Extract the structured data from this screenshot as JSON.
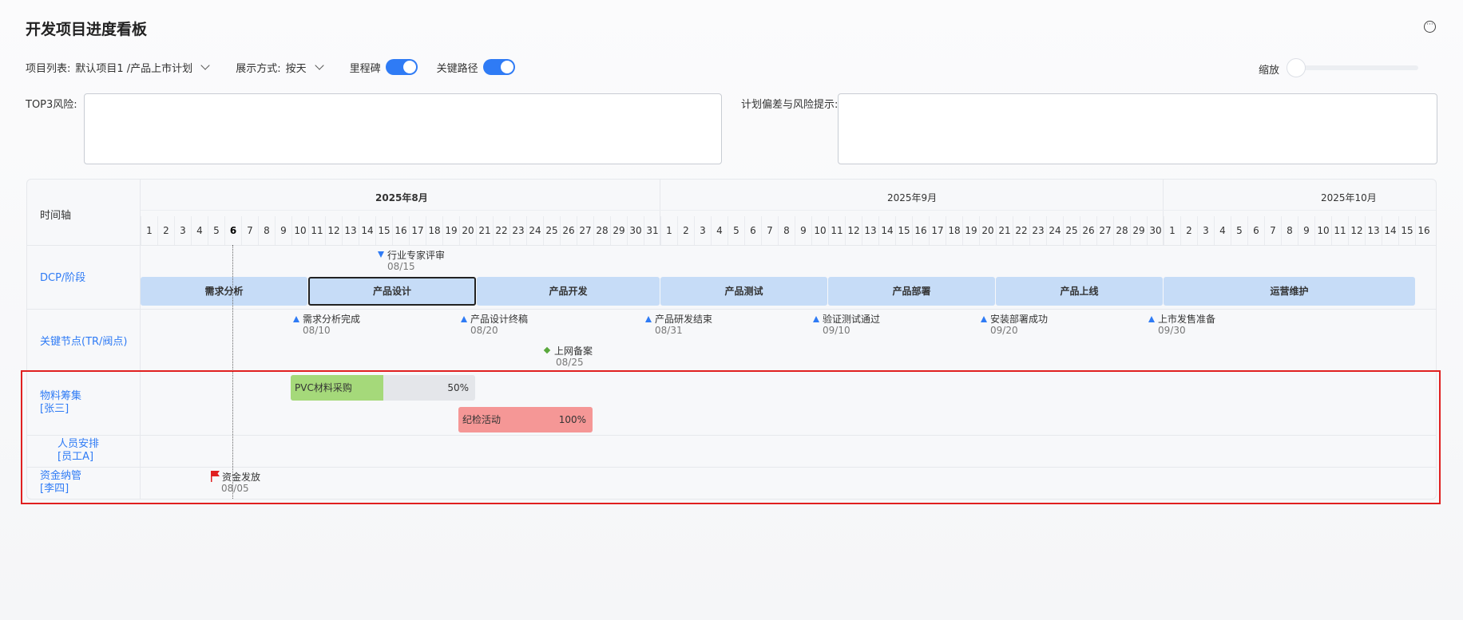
{
  "header": {
    "title": "开发项目进度看板",
    "more_icon": "more-circle-icon"
  },
  "filters": {
    "project_label": "项目列表:",
    "project_value": "默认项目1 /产品上市计划",
    "display_label": "展示方式:",
    "display_value": "按天",
    "milestone_label": "里程碑",
    "milestone_on": true,
    "critical_label": "关键路径",
    "critical_on": true,
    "zoom_label": "缩放",
    "zoom_value": 0
  },
  "risk": {
    "top3_label": "TOP3风险:",
    "top3_value": "",
    "deviation_label": "计划偏差与风险提示:",
    "deviation_value": ""
  },
  "gantt": {
    "axis_label": "时间轴",
    "months": [
      {
        "label": "2025年8月",
        "days": [
          "1",
          "2",
          "3",
          "4",
          "5",
          "6",
          "7",
          "8",
          "9",
          "10",
          "11",
          "12",
          "13",
          "14",
          "15",
          "16",
          "17",
          "18",
          "19",
          "20",
          "21",
          "22",
          "23",
          "24",
          "25",
          "26",
          "27",
          "28",
          "29",
          "30",
          "31"
        ],
        "current": true
      },
      {
        "label": "2025年9月",
        "days": [
          "1",
          "2",
          "3",
          "4",
          "5",
          "6",
          "7",
          "8",
          "9",
          "10",
          "11",
          "12",
          "13",
          "14",
          "15",
          "16",
          "17",
          "18",
          "19",
          "20",
          "21",
          "22",
          "23",
          "24",
          "25",
          "26",
          "27",
          "28",
          "29",
          "30"
        ],
        "current": false
      },
      {
        "label": "2025年10月",
        "days": [
          "1",
          "2",
          "3",
          "4",
          "5",
          "6",
          "7",
          "8",
          "9",
          "10",
          "11",
          "12",
          "13",
          "14",
          "15",
          "16"
        ],
        "current": false
      }
    ],
    "today": "2025-08-06",
    "rows": {
      "phase": "DCP/阶段",
      "milestones": "关键节点(TR/阀点)",
      "material": "物料筹集\n[张三]",
      "material_name": "物料筹集",
      "material_owner": "[张三]",
      "staff_name": "人员安排",
      "staff_owner": "[员工A]",
      "fund_name": "资金纳管",
      "fund_owner": "[李四]"
    },
    "dcp_review": {
      "label": "行业专家评审",
      "date": "08/15"
    },
    "phases": [
      {
        "label": "需求分析",
        "active": false
      },
      {
        "label": "产品设计",
        "active": true
      },
      {
        "label": "产品开发",
        "active": false
      },
      {
        "label": "产品测试",
        "active": false
      },
      {
        "label": "产品部署",
        "active": false
      },
      {
        "label": "产品上线",
        "active": false
      },
      {
        "label": "运营维护",
        "active": false
      }
    ],
    "milestones": [
      {
        "label": "需求分析完成",
        "date": "08/10"
      },
      {
        "label": "产品设计终稿",
        "date": "08/20"
      },
      {
        "label": "产品研发结束",
        "date": "08/31"
      },
      {
        "label": "验证测试通过",
        "date": "09/10"
      },
      {
        "label": "安装部署成功",
        "date": "09/20"
      },
      {
        "label": "上市发售准备",
        "date": "09/30"
      },
      {
        "label": "上网备案",
        "date": "08/25"
      }
    ],
    "tasks": [
      {
        "name": "PVC材料采购",
        "progress_label": "50%",
        "progress": 0.5,
        "color": "#a5d97a"
      },
      {
        "name": "纪检活动",
        "progress_label": "100%",
        "progress": 1.0,
        "color": "#f59796"
      }
    ],
    "fund_event": {
      "label": "资金发放",
      "date": "08/05"
    },
    "colors": {
      "accent": "#2f7bf5",
      "phase": "#c6dcf7",
      "selection": "#e02020"
    }
  }
}
